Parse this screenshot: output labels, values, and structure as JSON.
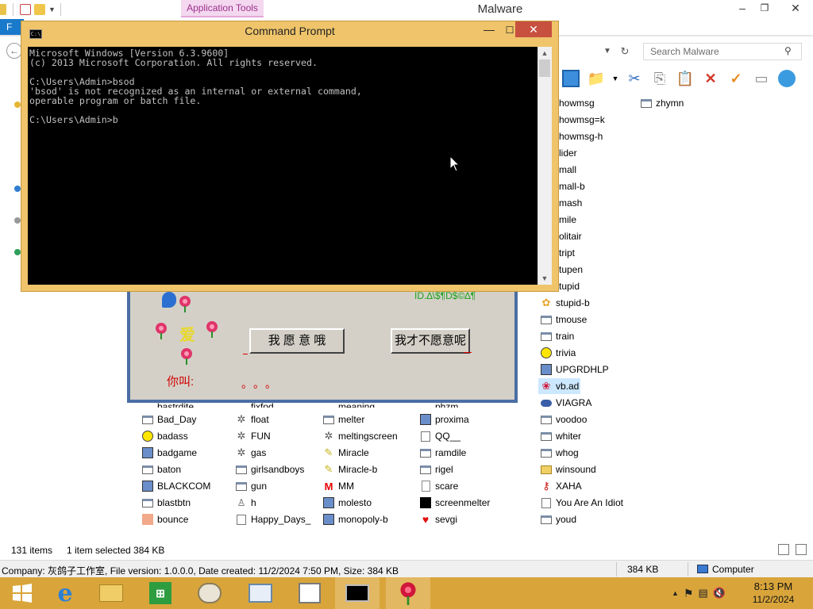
{
  "explorer": {
    "window_title": "Malware",
    "contextual_tab": "Application Tools",
    "ribbon_file_tab": "F",
    "search_placeholder": "Search Malware",
    "status": {
      "items_count": "131 items",
      "selection": "1 item selected  384 KB"
    },
    "details": {
      "info": "Company: 灰鸽子工作室, File version: 1.0.0.0, Date created: 11/2/2024 7:50 PM, Size: 384 KB",
      "size": "384 KB",
      "location": "Computer"
    },
    "right_column_partial": [
      "howmsg",
      "howmsg=k",
      "howmsg-h",
      "lider",
      "mall",
      "mall-b",
      "mash",
      "mile",
      "olitair",
      "tript",
      "tupen",
      "tupid"
    ],
    "right_column": [
      {
        "name": "stupid-b",
        "icon": "flower-icon"
      },
      {
        "name": "tmouse",
        "icon": "app-icon"
      },
      {
        "name": "train",
        "icon": "app-icon"
      },
      {
        "name": "trivia",
        "icon": "smiley-icon"
      },
      {
        "name": "UPGRDHLP",
        "icon": "setup-icon"
      },
      {
        "name": "vb.ad",
        "icon": "rose-icon",
        "selected": true
      },
      {
        "name": "VIAGRA",
        "icon": "pill-icon"
      },
      {
        "name": "voodoo",
        "icon": "app-icon"
      },
      {
        "name": "whiter",
        "icon": "app-icon"
      },
      {
        "name": "whog",
        "icon": "app-icon"
      },
      {
        "name": "winsound",
        "icon": "folder-icon"
      },
      {
        "name": "XAHA",
        "icon": "key-icon"
      },
      {
        "name": "You Are An Idiot",
        "icon": "shortcut-icon"
      },
      {
        "name": "youd",
        "icon": "app-icon"
      }
    ],
    "far_right": [
      {
        "name": "zhymn",
        "icon": "app-icon"
      }
    ],
    "grid_partial_row": [
      "bastrdite",
      "fixfod",
      "meaning",
      "phzm"
    ],
    "grid": [
      [
        {
          "name": "Bad_Day",
          "icon": "app-icon"
        },
        {
          "name": "float",
          "icon": "gear-icon"
        },
        {
          "name": "melter",
          "icon": "app-icon"
        },
        {
          "name": "proxima",
          "icon": "setup-icon"
        }
      ],
      [
        {
          "name": "badass",
          "icon": "smiley-icon"
        },
        {
          "name": "FUN",
          "icon": "gear-icon"
        },
        {
          "name": "meltingscreen",
          "icon": "gear-icon"
        },
        {
          "name": "QQ__",
          "icon": "shortcut-icon"
        }
      ],
      [
        {
          "name": "badgame",
          "icon": "setup-icon"
        },
        {
          "name": "gas",
          "icon": "gear-icon"
        },
        {
          "name": "Miracle",
          "icon": "tag-icon"
        },
        {
          "name": "ramdile",
          "icon": "app-icon"
        }
      ],
      [
        {
          "name": "baton",
          "icon": "app-icon"
        },
        {
          "name": "girlsandboys",
          "icon": "app-icon"
        },
        {
          "name": "Miracle-b",
          "icon": "tag-icon"
        },
        {
          "name": "rigel",
          "icon": "app-icon"
        }
      ],
      [
        {
          "name": "BLACKCOM",
          "icon": "setup-icon"
        },
        {
          "name": "gun",
          "icon": "app-icon"
        },
        {
          "name": "MM",
          "icon": "mcdonalds-icon"
        },
        {
          "name": "scare",
          "icon": "doc-icon"
        }
      ],
      [
        {
          "name": "blastbtn",
          "icon": "app-icon"
        },
        {
          "name": "h",
          "icon": "person-icon"
        },
        {
          "name": "molesto",
          "icon": "setup-icon"
        },
        {
          "name": "screenmelter",
          "icon": "black-icon"
        }
      ],
      [
        {
          "name": "bounce",
          "icon": "pink-icon"
        },
        {
          "name": "Happy_Days_",
          "icon": "shortcut-icon"
        },
        {
          "name": "monopoly-b",
          "icon": "setup-icon"
        },
        {
          "name": "sevgi",
          "icon": "heart-icon"
        }
      ]
    ]
  },
  "cmd": {
    "title": "Command Prompt",
    "icon_text": "C:\\",
    "lines": [
      "Microsoft Windows [Version 6.3.9600]",
      "(c) 2013 Microsoft Corporation. All rights reserved.",
      "",
      "C:\\Users\\Admin>bsod",
      "'bsod' is not recognized as an internal or external command,",
      "operable program or batch file.",
      "",
      "C:\\Users\\Admin>b"
    ]
  },
  "cn_dialog": {
    "ask": "你叫:",
    "dots": "。。。",
    "love_char": "爱",
    "btn_yes": "我 愿 意 哦",
    "btn_no": "我才不愿意呢",
    "green_text": "ID.∆\\$¶D$©∆¶"
  },
  "taskbar": {
    "time": "8:13 PM",
    "date": "11/2/2024"
  }
}
